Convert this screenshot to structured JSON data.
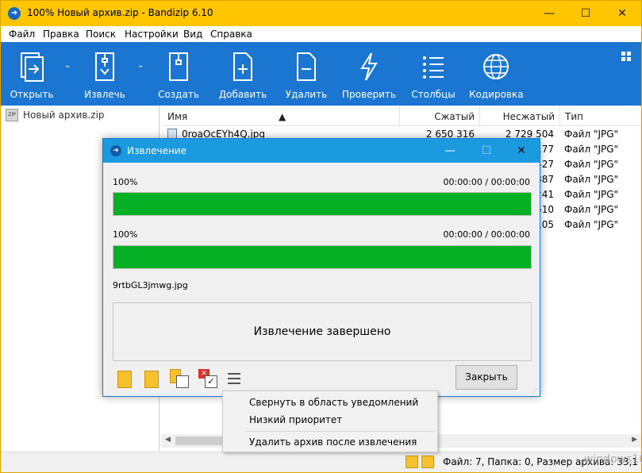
{
  "window": {
    "title": "100% Новый архив.zip - Bandizip 6.10",
    "minimize": "—",
    "maximize": "☐",
    "close": "✕"
  },
  "menu": [
    "Файл",
    "Правка",
    "Поиск",
    "Настройки",
    "Вид",
    "Справка"
  ],
  "toolbar": {
    "open": "Открыть",
    "extract": "Извлечь",
    "create": "Создать",
    "add": "Добавить",
    "delete": "Удалить",
    "test": "Проверить",
    "columns": "Столбцы",
    "encoding": "Кодировка"
  },
  "tree": {
    "archive": "Новый архив.zip",
    "zip_badge": "ZIP"
  },
  "list": {
    "columns": {
      "name": "Имя",
      "compressed": "Сжатый",
      "uncompressed": "Несжатый",
      "type": "Тип"
    },
    "rows": [
      {
        "name": "0roaOcEYh4Q.jpg",
        "compressed": "2 650 316",
        "uncompressed": "2 729 504",
        "type": "Файл \"JPG\""
      },
      {
        "uncompressed_tail": "177",
        "type": "Файл \"JPG\""
      },
      {
        "uncompressed_tail": "427",
        "type": "Файл \"JPG\""
      },
      {
        "uncompressed_tail": "387",
        "type": "Файл \"JPG\""
      },
      {
        "uncompressed_tail": "241",
        "type": "Файл \"JPG\""
      },
      {
        "uncompressed_tail": "510",
        "type": "Файл \"JPG\""
      },
      {
        "uncompressed_tail": "105",
        "type": "Файл \"JPG\""
      }
    ]
  },
  "status": {
    "text": "Файл: 7, Папка: 0, Размер архива: 33,1 МБ"
  },
  "dialog": {
    "title": "Извлечение",
    "progress1": {
      "percent_label": "100%",
      "percent": 100,
      "time": "00:00:00 / 00:00:00"
    },
    "progress2": {
      "percent_label": "100%",
      "percent": 100,
      "time": "00:00:00 / 00:00:00"
    },
    "current_file": "9rtbGL3jmwg.jpg",
    "result": "Извлечение завершено",
    "close_label": "Закрыть"
  },
  "context_menu": {
    "minimize_to_tray": "Свернуть в область уведомлений",
    "low_priority": "Низкий приоритет",
    "delete_after": "Удалить архив после извлечения"
  },
  "watermark": "windows10"
}
